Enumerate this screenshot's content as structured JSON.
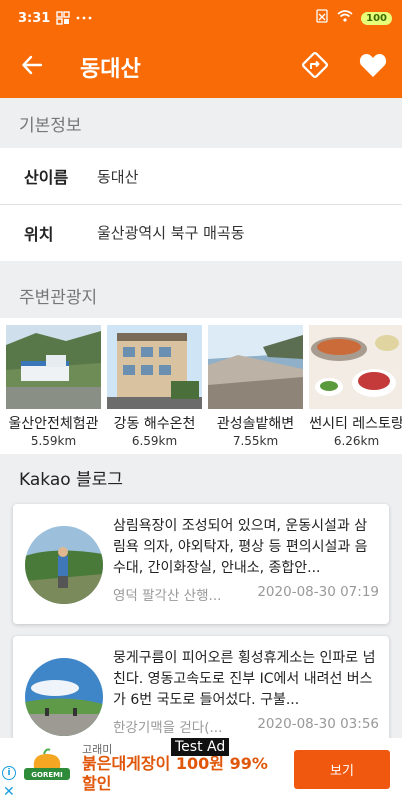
{
  "status": {
    "time": "3:31",
    "battery": "100"
  },
  "appbar": {
    "title": "동대산"
  },
  "basic_info": {
    "header": "기본정보",
    "rows": [
      {
        "key": "산이름",
        "value": "동대산"
      },
      {
        "key": "위치",
        "value": "울산광역시 북구 매곡동"
      }
    ]
  },
  "nearby": {
    "header": "주변관광지",
    "spots": [
      {
        "name": "울산안전체험관",
        "distance": "5.59km"
      },
      {
        "name": "강동 해수온천",
        "distance": "6.59km"
      },
      {
        "name": "관성솔밭해변",
        "distance": "7.55km"
      },
      {
        "name": "썬시티 레스토랑",
        "distance": "6.26km"
      }
    ]
  },
  "blog": {
    "header": "Kakao 블로그",
    "posts": [
      {
        "text": "삼림욕장이 조성되어 있으며, 운동시설과 삼림욕 의자, 야외탁자, 평상 등 편의시설과 음수대, 간이화장실, 안내소, 종합안...",
        "source": "영덕 팔각산 산행...",
        "date": "2020-08-30 07:19"
      },
      {
        "text": "뭉게구름이 피어오른 횡성휴게소는 인파로 넘친다. 영동고속도로 진부 IC에서 내려선 버스가 6번 국도로 들어섰다. 구불...",
        "source": "한강기맥을 걷다(...",
        "date": "2020-08-30 03:56"
      }
    ]
  },
  "ad": {
    "label": "Test Ad",
    "brand": "고래미",
    "logo_text": "GOREMI",
    "headline": "붉은대게장이 100원 99% 할인",
    "cta": "보기",
    "info_glyph": "i",
    "close_glyph": "✕"
  },
  "colors": {
    "primary": "#f86b06",
    "cta": "#f0570f",
    "background": "#eeeff1"
  }
}
